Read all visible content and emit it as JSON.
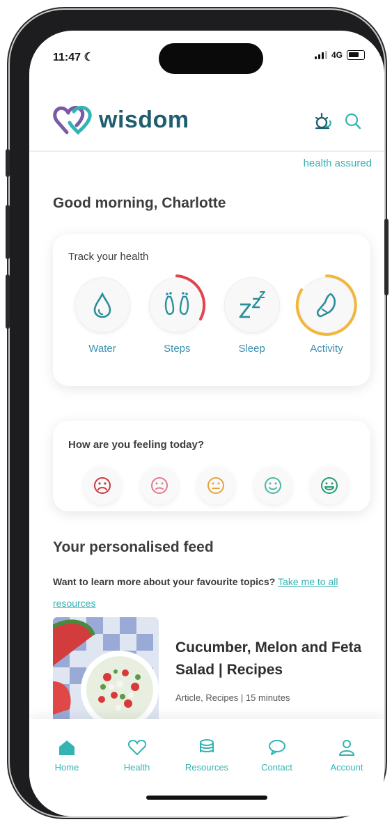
{
  "status": {
    "time": "11:47",
    "network": "4G"
  },
  "header": {
    "logo_text": "wisdom",
    "brand_tag": "health assured"
  },
  "greeting": "Good morning, Charlotte",
  "track": {
    "title": "Track your health",
    "items": [
      {
        "label": "Water",
        "icon": "water-drop-icon"
      },
      {
        "label": "Steps",
        "icon": "footprints-icon"
      },
      {
        "label": "Sleep",
        "icon": "sleep-zzz-icon"
      },
      {
        "label": "Activity",
        "icon": "activity-icon"
      }
    ]
  },
  "mood": {
    "title": "How are you feeling today?",
    "options": [
      "very-sad-face-icon",
      "sad-face-icon",
      "neutral-face-icon",
      "happy-face-icon",
      "very-happy-face-icon"
    ]
  },
  "feed": {
    "title": "Your personalised feed",
    "subtitle": "Want to learn more about your favourite topics?",
    "link": "Take me to all resources",
    "article": {
      "title": "Cucumber, Melon and Feta Salad | Recipes",
      "meta": "Article, Recipes | 15 minutes"
    }
  },
  "tabs": [
    {
      "label": "Home",
      "icon": "home-icon"
    },
    {
      "label": "Health",
      "icon": "heart-icon"
    },
    {
      "label": "Resources",
      "icon": "layers-icon"
    },
    {
      "label": "Contact",
      "icon": "chat-bubble-icon"
    },
    {
      "label": "Account",
      "icon": "user-icon"
    }
  ],
  "colors": {
    "brand": "#1f5e6e",
    "accent": "#34b3b3",
    "steps_ring": "#e0454b",
    "activity_ring": "#f2b63a"
  }
}
